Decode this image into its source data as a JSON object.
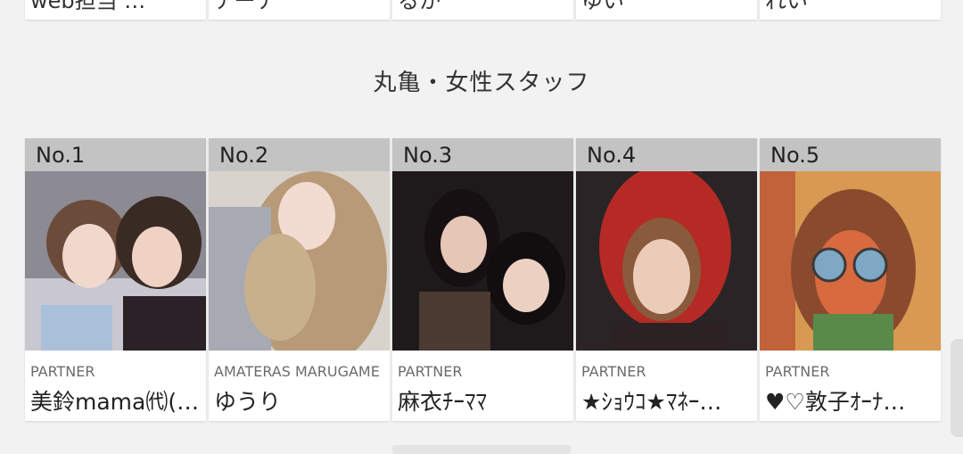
{
  "previous_row": [
    "web担当 …",
    "アーチ",
    "るか",
    "ゆい",
    "れい"
  ],
  "section": {
    "title": "丸亀・女性スタッフ"
  },
  "ranking": [
    {
      "rank": "No.1",
      "role": "PARTNER",
      "name": "美鈴mama㈹(…",
      "photo_icon": "portrait-photo"
    },
    {
      "rank": "No.2",
      "role": "AMATERAS MARUGAME",
      "name": "ゆうり",
      "photo_icon": "portrait-photo"
    },
    {
      "rank": "No.3",
      "role": "PARTNER",
      "name": "麻衣ﾁｰﾏﾏ",
      "photo_icon": "portrait-photo"
    },
    {
      "rank": "No.4",
      "role": "PARTNER",
      "name": "★ｼｮｳｺ★ﾏﾈｰ…",
      "photo_icon": "portrait-photo"
    },
    {
      "rank": "No.5",
      "role": "PARTNER",
      "name": "♥♡敦子ｵｰﾅ…",
      "photo_icon": "portrait-photo"
    }
  ],
  "colors": {
    "background": "#f2f2f2",
    "rank_bar": "#c3c3c3",
    "card": "#ffffff",
    "role_text": "#6b6b6b"
  }
}
